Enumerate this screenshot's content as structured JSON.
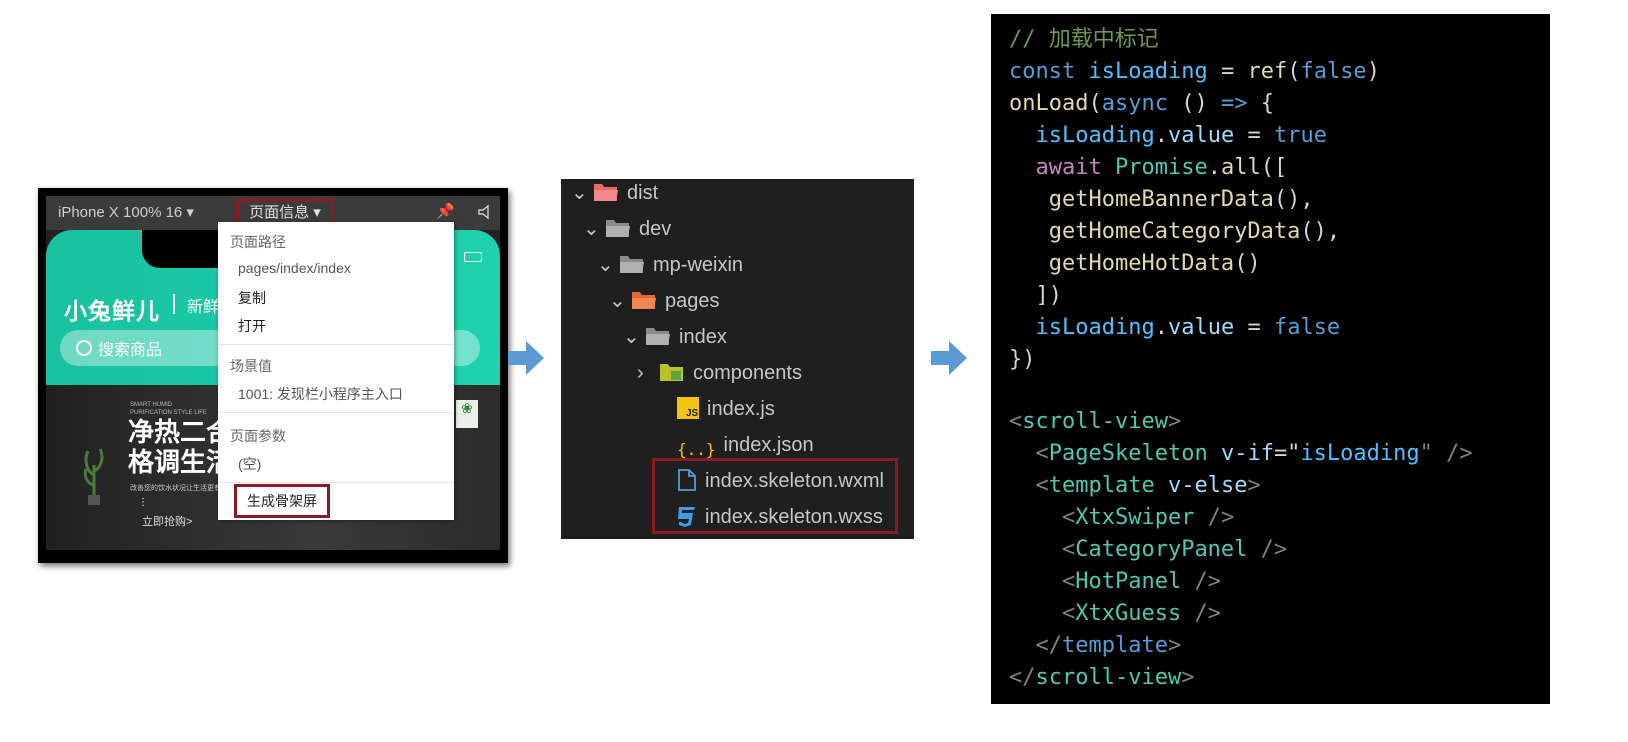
{
  "simulator": {
    "device": "iPhone X 100% 16 ▾",
    "page_info_button": "页面信息 ▾",
    "app": {
      "brand": "小兔鲜儿",
      "brand_sub": "新鲜",
      "search_placeholder": "搜索商品"
    },
    "banner": {
      "small_text": "SMART HUMID\nPURIFICATION STYLE LIFE",
      "title": "净热二合\n格调生活",
      "desc": "改善您的饮水状况让生活更有仪式",
      "cta": "立即抢购>"
    },
    "dropdown": {
      "path_heading": "页面路径",
      "path_value": "pages/index/index",
      "copy": "复制",
      "open": "打开",
      "scene_heading": "场景值",
      "scene_value": "1001: 发现栏小程序主入口",
      "params_heading": "页面参数",
      "params_value": "(空)",
      "generate_skeleton": "生成骨架屏"
    }
  },
  "explorer": {
    "items": [
      {
        "label": "dist",
        "icon": "folder-open-icon",
        "chevron": "down"
      },
      {
        "label": "dev",
        "icon": "folder-open-icon",
        "chevron": "down"
      },
      {
        "label": "mp-weixin",
        "icon": "folder-open-icon",
        "chevron": "down"
      },
      {
        "label": "pages",
        "icon": "folder-open-icon",
        "chevron": "down"
      },
      {
        "label": "index",
        "icon": "folder-open-icon",
        "chevron": "down"
      },
      {
        "label": "components",
        "icon": "folder-icon",
        "chevron": "right"
      },
      {
        "label": "index.js",
        "icon": "js-file-icon"
      },
      {
        "label": "index.json",
        "icon": "json-file-icon"
      },
      {
        "label": "index.skeleton.wxml",
        "icon": "file-icon"
      },
      {
        "label": "index.skeleton.wxss",
        "icon": "css-file-icon"
      }
    ]
  },
  "code": {
    "comment": "// 加载中标记",
    "l2": {
      "kw": "const",
      "var": "isLoading",
      "eq": " = ",
      "fn": "ref",
      "p1": "(",
      "val": "false",
      "p2": ")"
    },
    "l3": {
      "fn": "onLoad",
      "p1": "(",
      "kw": "async",
      "rest": " () ",
      "arrow": "=>",
      "brace": " {"
    },
    "l4": {
      "var": "isLoading",
      "dot": ".",
      "prop": "value",
      "eq": " = ",
      "val": "true"
    },
    "l5": {
      "kw": "await",
      "cls": "Promise",
      "dot": ".",
      "fn": "all",
      "rest": "(["
    },
    "l6": {
      "fn": "getHomeBannerData",
      "rest": "(),"
    },
    "l7": {
      "fn": "getHomeCategoryData",
      "rest": "(),"
    },
    "l8": {
      "fn": "getHomeHotData",
      "rest": "()"
    },
    "l9": "])",
    "l10": {
      "var": "isLoading",
      "dot": ".",
      "prop": "value",
      "eq": " = ",
      "val": "false"
    },
    "l11": "})",
    "l12": {
      "tag": "scroll-view"
    },
    "l13": {
      "tag": "PageSkeleton",
      "attr": "v-if",
      "eq": "=\"",
      "val": "isLoading",
      "close": "\" />"
    },
    "l14": {
      "tag": "template",
      "attr": "v-else"
    },
    "l15": "XtxSwiper",
    "l16": "CategoryPanel",
    "l17": "HotPanel",
    "l18": "XtxGuess",
    "l19": "template",
    "l20": "scroll-view"
  },
  "colors": {
    "highlight_border": "#8b1a24",
    "arrow": "#5b9bd5",
    "header_green": "#1fc9a8"
  }
}
